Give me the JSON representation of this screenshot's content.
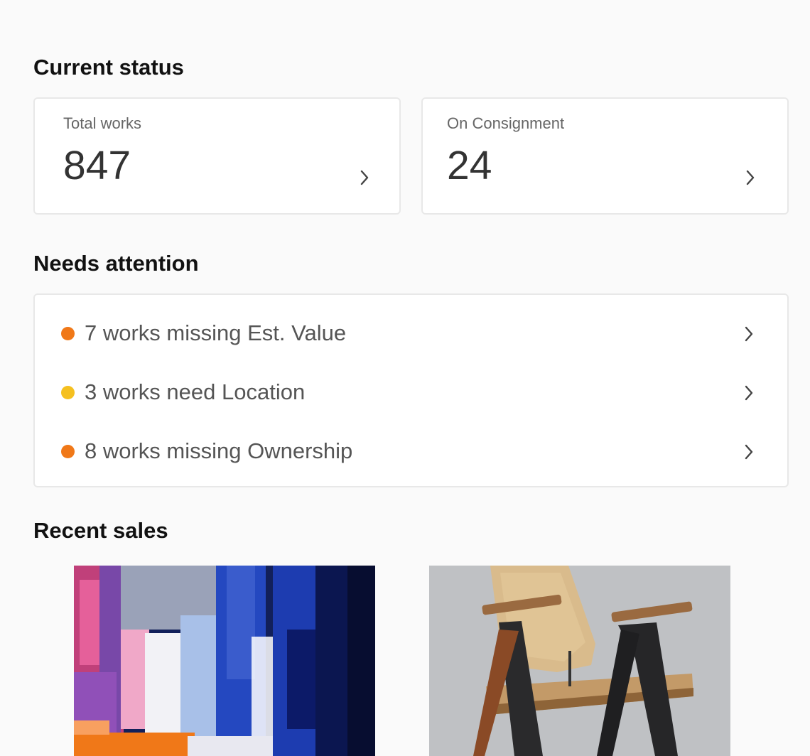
{
  "sections": {
    "current_status": "Current status",
    "needs_attention": "Needs attention",
    "recent_sales": "Recent sales"
  },
  "stats": [
    {
      "label": "Total works",
      "value": "847"
    },
    {
      "label": "On Consignment",
      "value": "24"
    }
  ],
  "attention": [
    {
      "text": "7 works missing Est. Value",
      "color": "#f07818"
    },
    {
      "text": "3 works need Location",
      "color": "#f5c020"
    },
    {
      "text": "8 works missing Ownership",
      "color": "#f07818"
    }
  ],
  "recent_sales": [
    {
      "image": "abstract-painting"
    },
    {
      "image": "wooden-chair"
    }
  ],
  "colors": {
    "background": "#fafafa",
    "card_border": "#e8e8e8",
    "accent_orange": "#f07818",
    "accent_yellow": "#f5c020"
  }
}
